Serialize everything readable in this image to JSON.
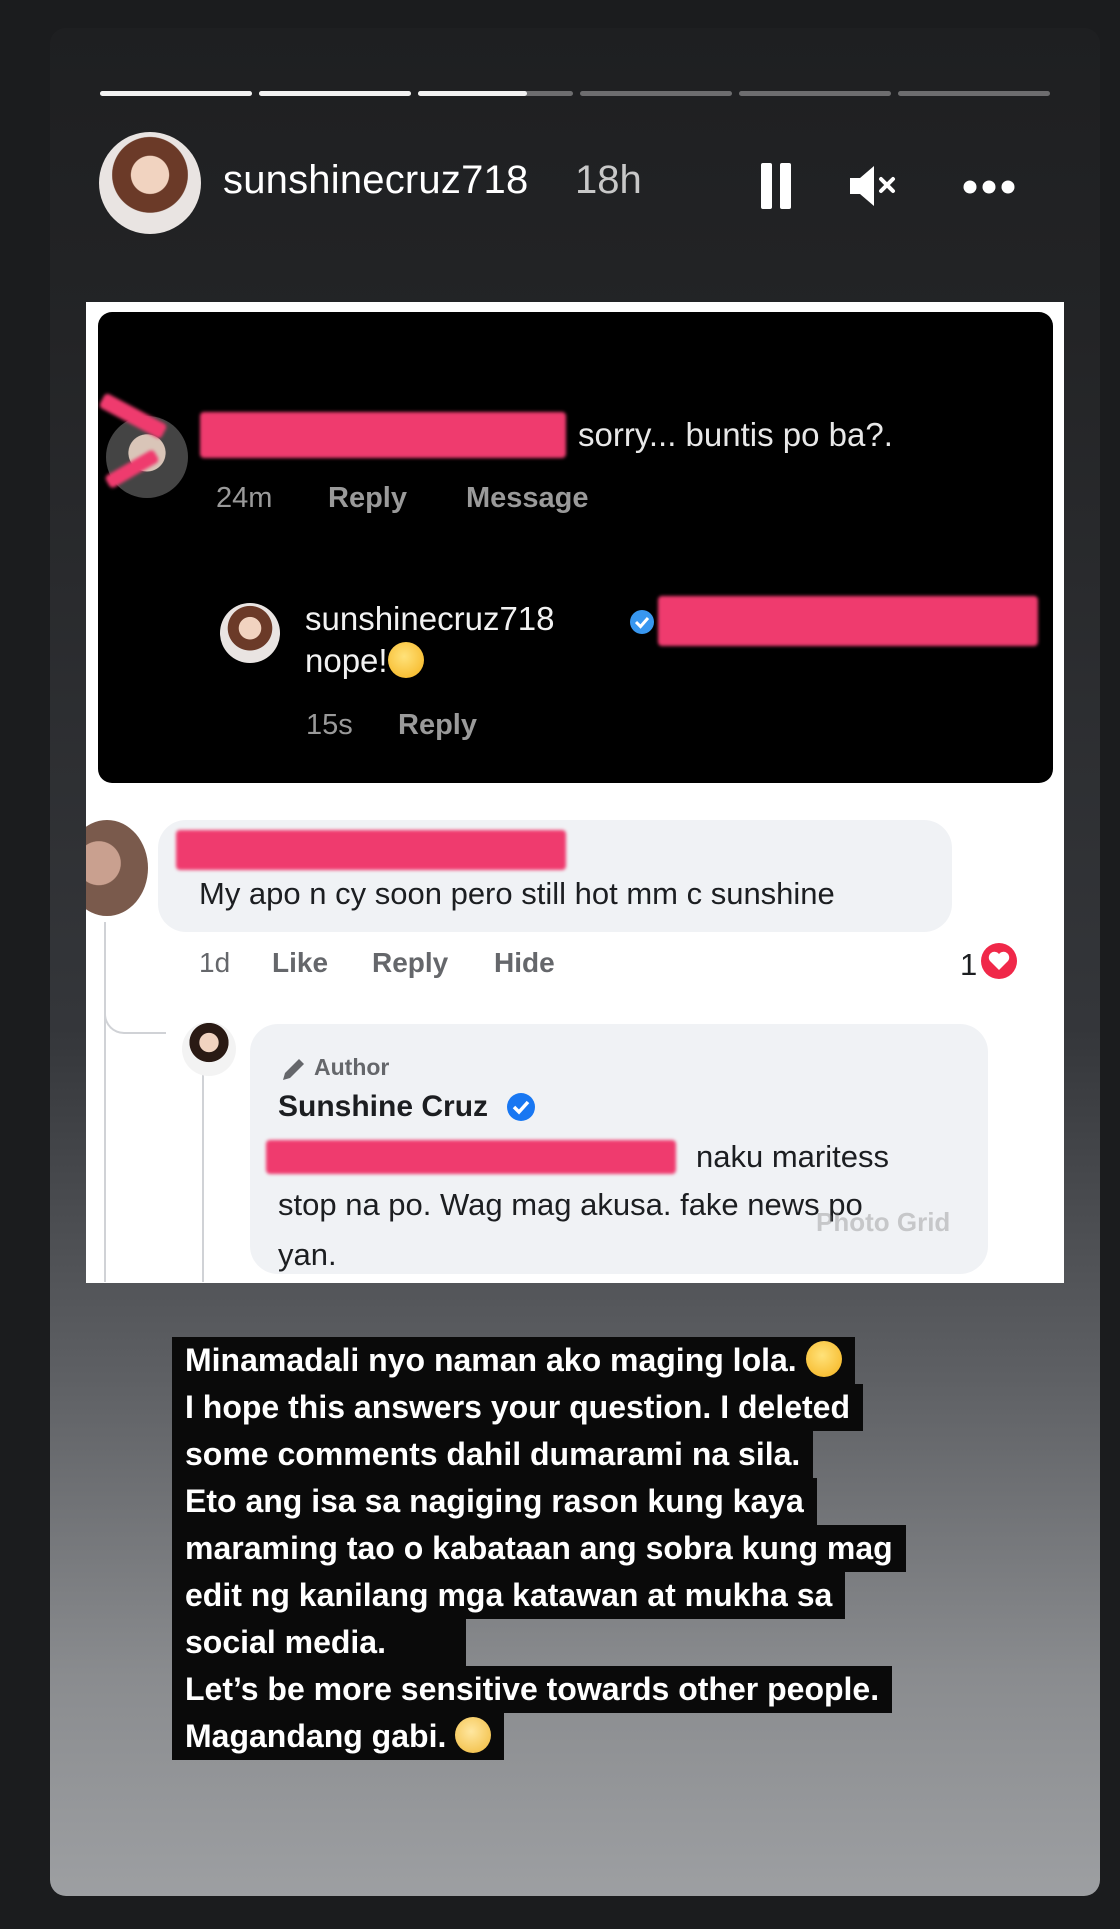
{
  "story": {
    "username": "sunshinecruz718",
    "time_ago": "18h",
    "progress_segments": [
      1,
      1,
      0.7,
      0,
      0,
      0
    ]
  },
  "ig_comments": {
    "first_comment": {
      "text": "sorry... buntis po  ba?.",
      "time": "24m",
      "reply": "Reply",
      "message": "Message"
    },
    "reply_comment": {
      "username": "sunshinecruz718",
      "text": "nope!",
      "time": "15s",
      "reply": "Reply"
    }
  },
  "fb_comments": {
    "comment": {
      "text": "My apo n cy soon pero still hot mm c sunshine",
      "time": "1d",
      "like": "Like",
      "reply": "Reply",
      "hide": "Hide",
      "reactions": "1"
    },
    "author_reply": {
      "badge": "Author",
      "name": "Sunshine Cruz",
      "line1": "naku maritess",
      "line2": "stop na po. Wag mag akusa. fake news po",
      "line3": "yan.",
      "watermark": "Photo Grid"
    }
  },
  "caption": {
    "lines": [
      "Minamadali nyo naman ako maging lola.",
      "I hope this answers your question. I deleted",
      "some comments dahil dumarami na sila.",
      "Eto ang isa sa nagiging rason kung kaya",
      "maraming tao o kabataan ang sobra kung mag",
      "edit ng kanilang mga katawan at mukha sa",
      "social media.",
      "Let’s be more sensitive towards other people.",
      "Magandang gabi."
    ]
  },
  "colors": {
    "redaction": "#ef3b6e",
    "verified": "#3897f0",
    "heart": "#f02849"
  }
}
